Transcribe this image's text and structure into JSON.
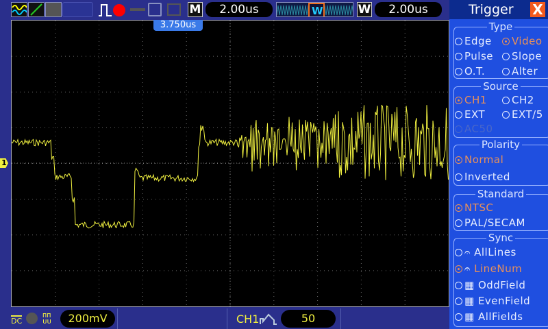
{
  "toolbar": {
    "mode_badge": "M",
    "main_timebase": "2.00us",
    "window_badge": "W",
    "window_timebase": "2.00us",
    "trigger_position": "3.750us"
  },
  "bottom": {
    "coupling": "DC",
    "volts_div": "200mV",
    "trigger_source": "CH1",
    "trigger_level": "50"
  },
  "channel_marker": "1",
  "panel": {
    "title": "Trigger",
    "close": "X",
    "type": {
      "title": "Type",
      "options": [
        "Edge",
        "Video",
        "Pulse",
        "Slope",
        "O.T.",
        "Alter"
      ]
    },
    "source": {
      "title": "Source",
      "options": [
        "CH1",
        "CH2",
        "EXT",
        "EXT/5",
        "AC50"
      ]
    },
    "polarity": {
      "title": "Polarity",
      "options": [
        "Normal",
        "Inverted"
      ]
    },
    "standard": {
      "title": "Standard",
      "options": [
        "NTSC",
        "PAL/SECAM"
      ]
    },
    "sync": {
      "title": "Sync",
      "options": [
        "AllLines",
        "LineNum",
        "OddField",
        "EvenField",
        "AllFields"
      ]
    }
  },
  "colors": {
    "trace": "#f0f040",
    "selected": "#e8905a",
    "panel": "#1f4fe0"
  }
}
